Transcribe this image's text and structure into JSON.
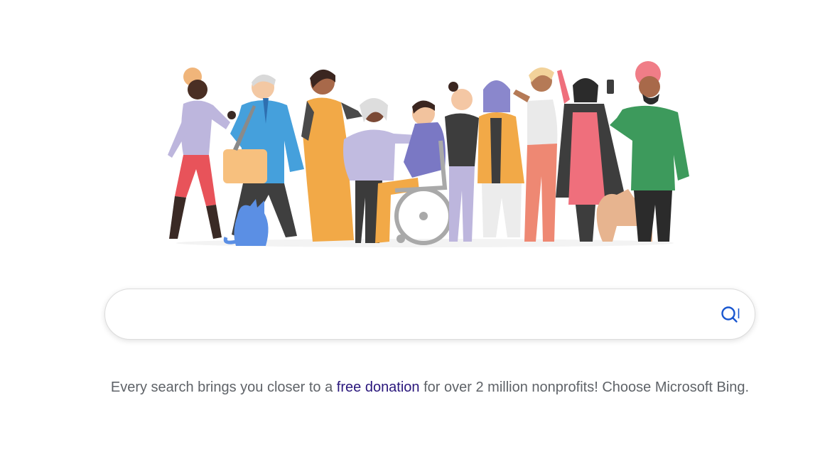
{
  "search": {
    "value": "",
    "placeholder": "",
    "icon": "search-icon"
  },
  "tagline": {
    "before": "Every search brings you closer to a ",
    "link": "free donation",
    "after": " for over 2 million nonprofits! Choose Microsoft Bing."
  },
  "colors": {
    "link": "#2a177c",
    "text": "#5f6368",
    "search_icon": "#1a57d0"
  }
}
